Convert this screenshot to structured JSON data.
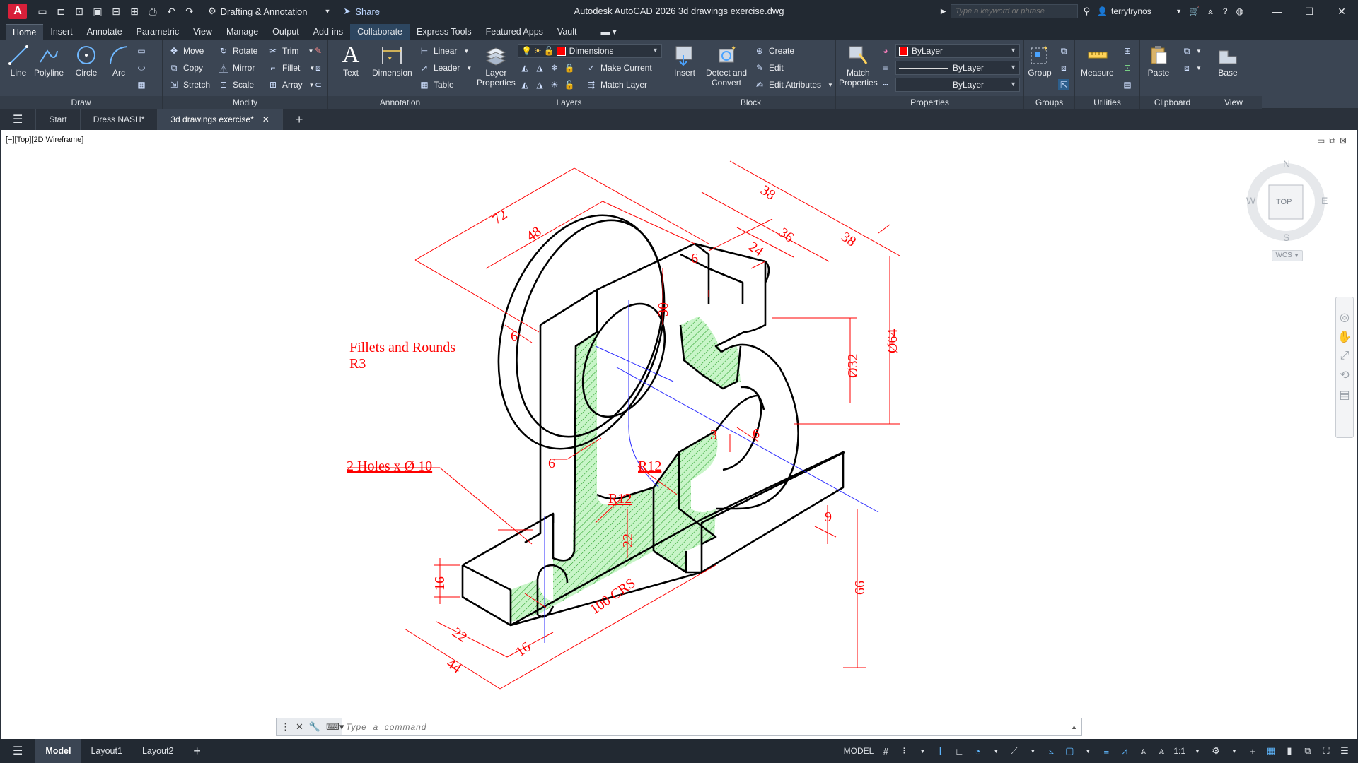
{
  "titlebar": {
    "app_logo": "A",
    "workspace": "Drafting & Annotation",
    "share": "Share",
    "title": "Autodesk AutoCAD 2026   3d drawings exercise.dwg",
    "search_placeholder": "Type a keyword or phrase",
    "user": "terrytrynos"
  },
  "ribbon_tabs": [
    "Home",
    "Insert",
    "Annotate",
    "Parametric",
    "View",
    "Manage",
    "Output",
    "Add-ins",
    "Collaborate",
    "Express Tools",
    "Featured Apps",
    "Vault"
  ],
  "ribbon": {
    "draw": {
      "title": "Draw",
      "line": "Line",
      "polyline": "Polyline",
      "circle": "Circle",
      "arc": "Arc"
    },
    "modify": {
      "title": "Modify",
      "move": "Move",
      "rotate": "Rotate",
      "trim": "Trim",
      "copy": "Copy",
      "mirror": "Mirror",
      "fillet": "Fillet",
      "stretch": "Stretch",
      "scale": "Scale",
      "array": "Array"
    },
    "annotation": {
      "title": "Annotation",
      "text": "Text",
      "dimension": "Dimension",
      "linear": "Linear",
      "leader": "Leader",
      "table": "Table"
    },
    "layers": {
      "title": "Layers",
      "layer_properties_1": "Layer",
      "layer_properties_2": "Properties",
      "current_layer": "Dimensions",
      "make_current": "Make Current",
      "match_layer": "Match Layer"
    },
    "block": {
      "title": "Block",
      "insert": "Insert",
      "detect_1": "Detect and",
      "detect_2": "Convert",
      "create": "Create",
      "edit": "Edit",
      "edit_attributes": "Edit Attributes"
    },
    "properties": {
      "title": "Properties",
      "match_1": "Match",
      "match_2": "Properties",
      "color": "ByLayer",
      "linetype": "ByLayer",
      "lineweight": "ByLayer"
    },
    "groups": {
      "title": "Groups",
      "group": "Group"
    },
    "utilities": {
      "title": "Utilities",
      "measure": "Measure"
    },
    "clipboard": {
      "title": "Clipboard",
      "paste": "Paste"
    },
    "view": {
      "title": "View",
      "base": "Base"
    }
  },
  "file_tabs": [
    "Start",
    "Dress NASH*",
    "3d drawings exercise*"
  ],
  "viewport": {
    "label": "[−][Top][2D Wireframe]",
    "viewcube": {
      "n": "N",
      "s": "S",
      "e": "E",
      "w": "W",
      "face": "TOP",
      "wcs": "WCS"
    }
  },
  "drawing": {
    "note_fillets_1": "Fillets and Rounds",
    "note_fillets_2": "R3",
    "note_holes": "2 Holes x Ø 10",
    "dims": {
      "d72": "72",
      "d48": "48",
      "d38a": "38",
      "d36": "36",
      "d38b": "38",
      "d24": "24",
      "d6top": "6",
      "d30": "30",
      "d64": "Ø64",
      "d32": "Ø32",
      "d6l": "6",
      "d6m": "6",
      "d3": "3",
      "d6r": "6",
      "r12a": "R12",
      "r12b": "R12",
      "d22v": "22",
      "d16v": "16",
      "d9": "9",
      "d66": "66",
      "d22": "22",
      "d16": "16",
      "d44": "44",
      "d100": "100 CRS"
    }
  },
  "command": {
    "placeholder": "Type  a  command"
  },
  "status": {
    "tabs": [
      "Model",
      "Layout1",
      "Layout2"
    ],
    "model": "MODEL",
    "scale": "1:1"
  }
}
